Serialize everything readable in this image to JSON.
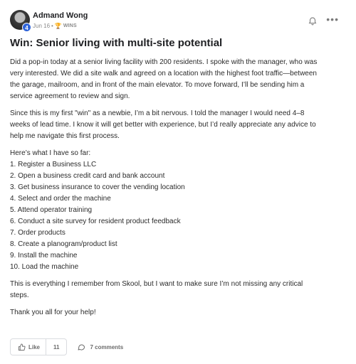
{
  "post": {
    "author": "Admand Wong",
    "level": "4",
    "date": "Jun 16",
    "separator": "•",
    "category": "WINS",
    "title": "Win: Senior living with multi-site potential",
    "paragraph1": [
      "Did a pop-in today at a senior living facility with 200 residents. I spoke with the manager, who was",
      "very interested. We did a site walk and agreed on a location with the highest foot traffic—between",
      "the garage, mailroom, and in front of the main elevator. To move forward, I’ll be sending him a",
      "service agreement to review and sign."
    ],
    "paragraph2": [
      "Since this is my first \"win\" as a newbie, I’m a bit nervous. I told the manager I would need 4–8",
      "weeks of lead time. I know it will get better with experience, but I’d really appreciate any advice to",
      "help me navigate this first process."
    ],
    "list_intro": "Here’s what I have so far:",
    "steps": [
      "1. Register a Business LLC",
      "2. Open a business credit card and bank account",
      "3. Get business insurance to cover the vending location",
      "4. Select and order the machine",
      "5. Attend operator training",
      "6. Conduct a site survey for resident product feedback",
      "7. Order products",
      "8. Create a planogram/product list",
      "9. Install the machine",
      "10. Load the machine"
    ],
    "paragraph3": [
      "This is everything I remember from Skool, but I want to make sure I’m not missing any critical",
      "steps."
    ],
    "closing": "Thank you all for your help!"
  },
  "actions": {
    "like_label": "Like",
    "like_count": "11",
    "comments_label": "7 comments"
  },
  "icons": {
    "bell": "bell-icon",
    "more": "more-icon",
    "like": "thumbs-up-icon",
    "comment": "comment-icon",
    "trophy": "trophy-icon"
  },
  "colors": {
    "level_badge": "#2e63d9"
  }
}
